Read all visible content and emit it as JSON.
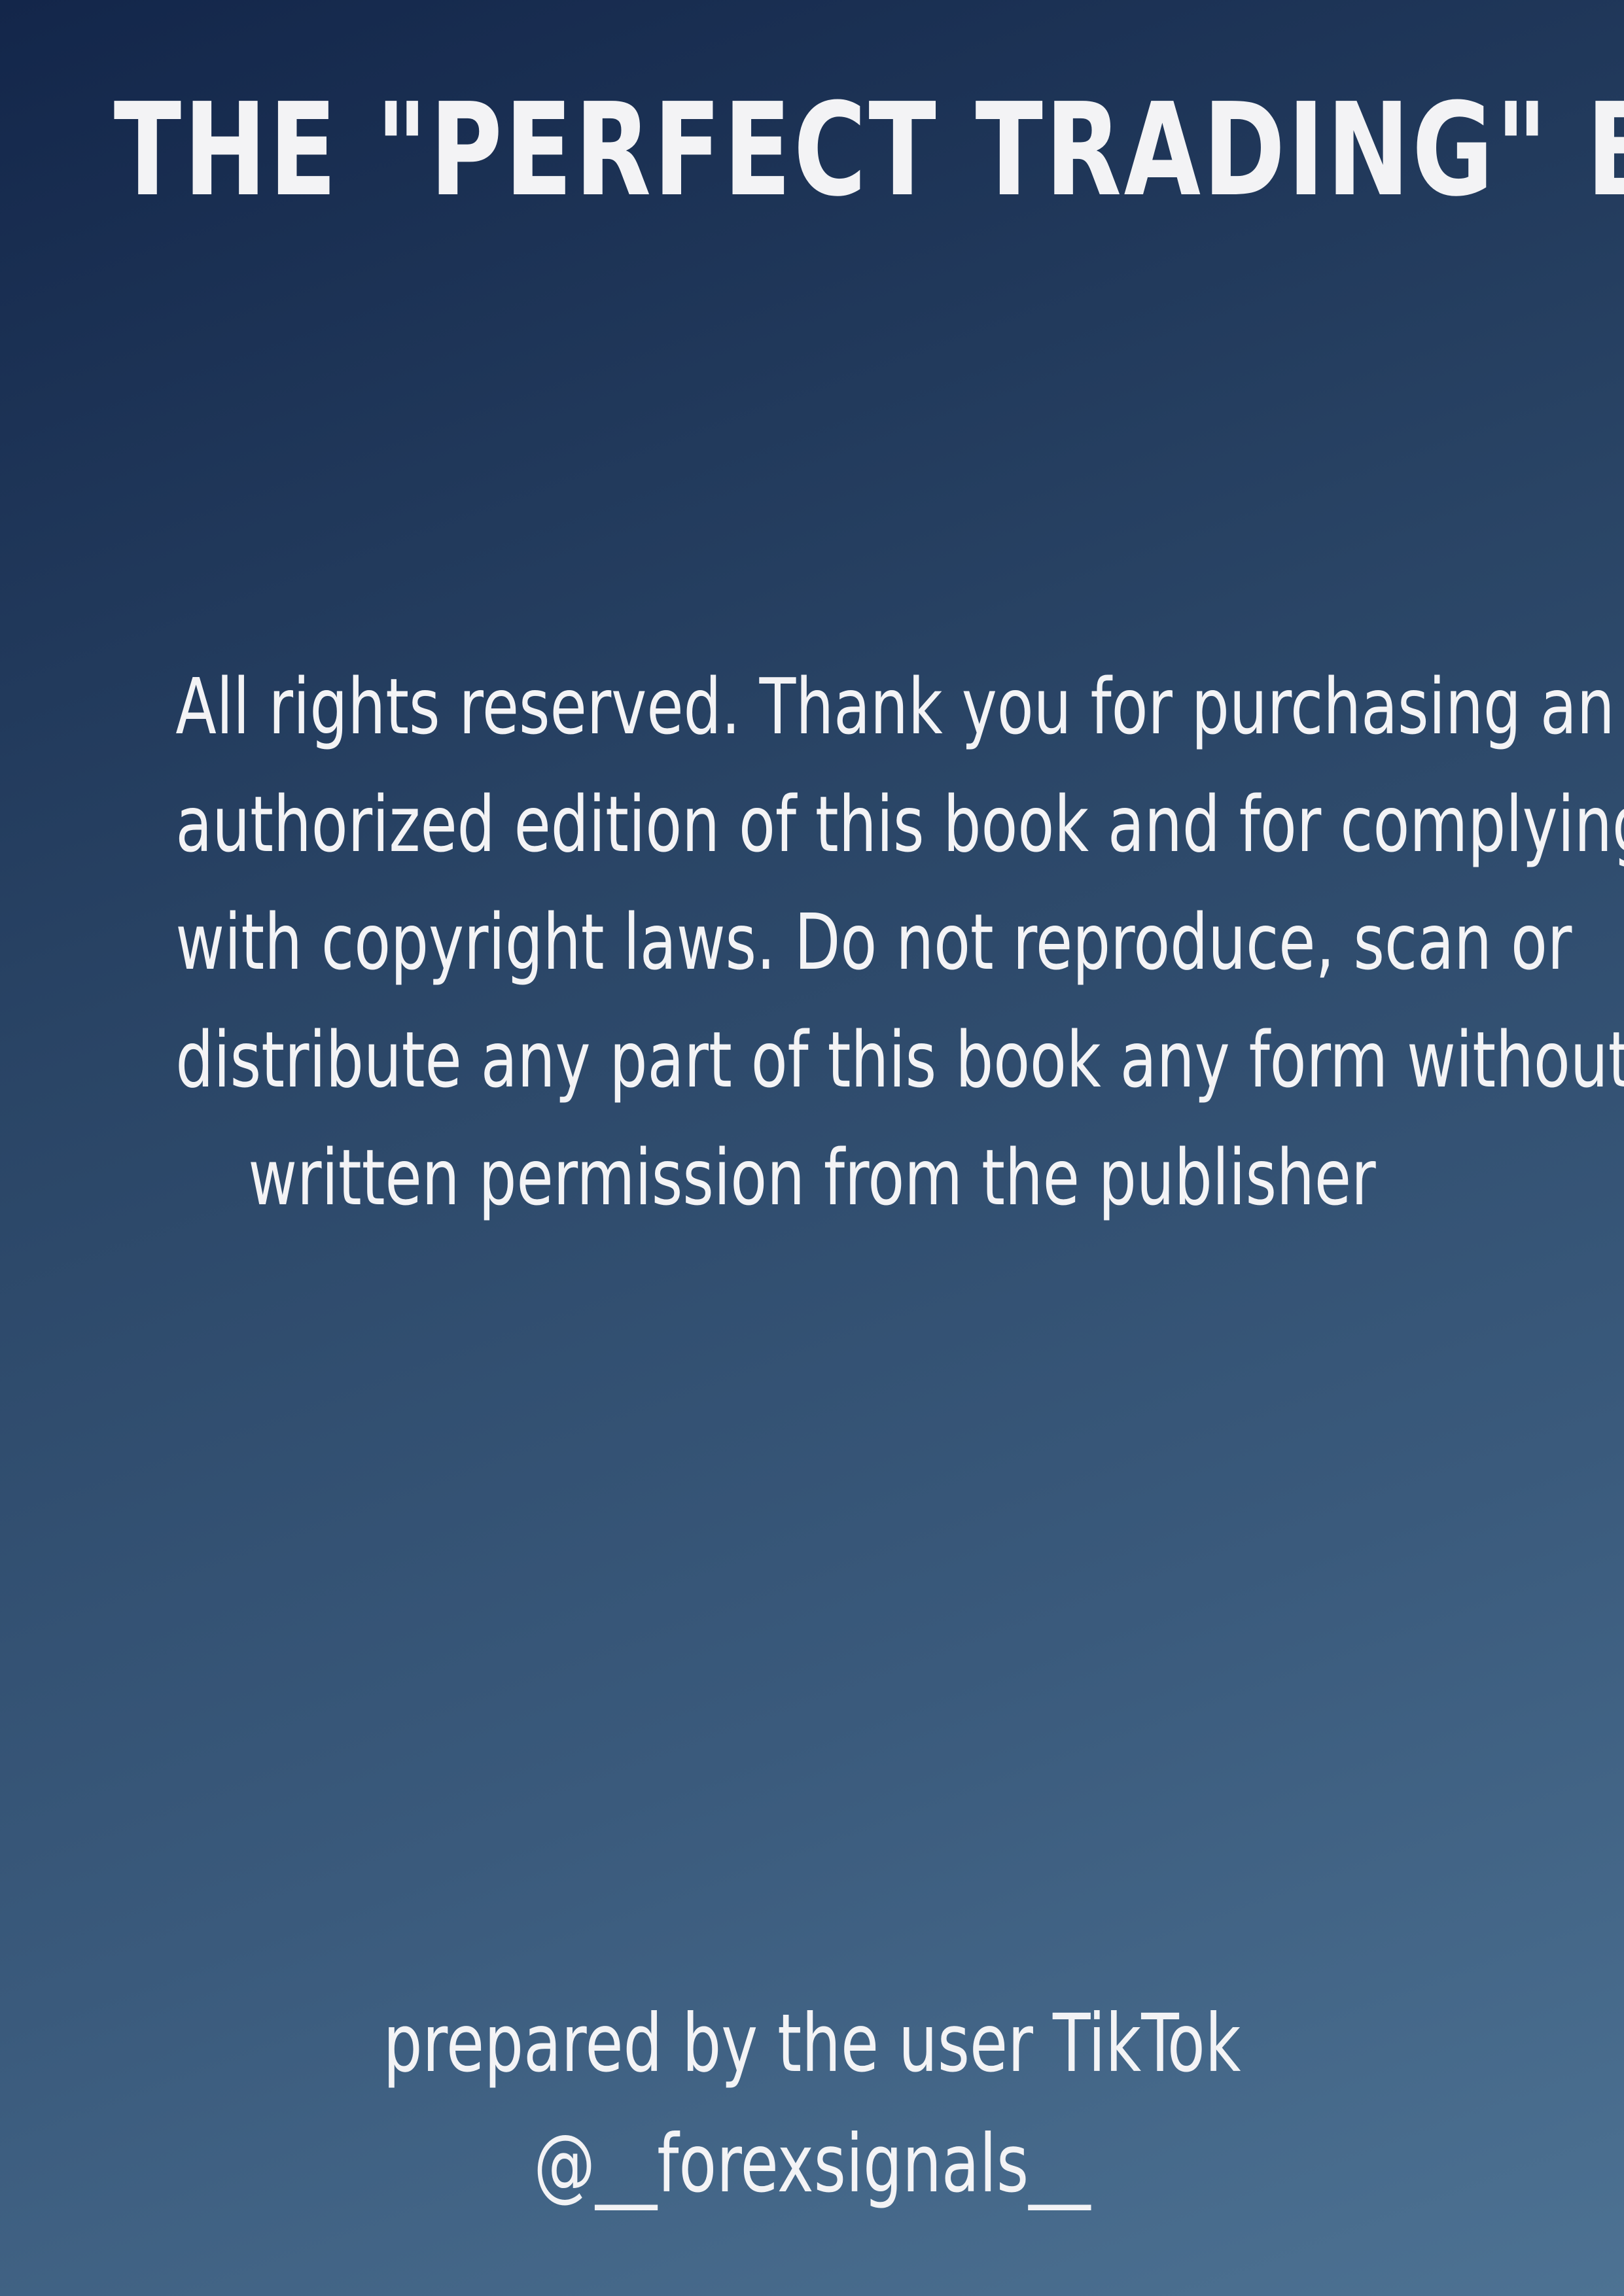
{
  "title": "THE \"PERFECT TRADING\" BOOK",
  "notice": {
    "lines": [
      "All rights reserved. Thank you for purchasing an",
      "authorized edition of this book and for complying",
      "with copyright laws. Do not reproduce, scan or",
      "distribute any part of this book  any form without",
      "written permission from the publisher"
    ]
  },
  "credit": {
    "lines": [
      "prepared by the user TikTok",
      "@__forexsignals__"
    ]
  },
  "colors": {
    "background_top": "#13264a",
    "background_bottom": "#4d7293",
    "text": "#f3f3f5"
  }
}
